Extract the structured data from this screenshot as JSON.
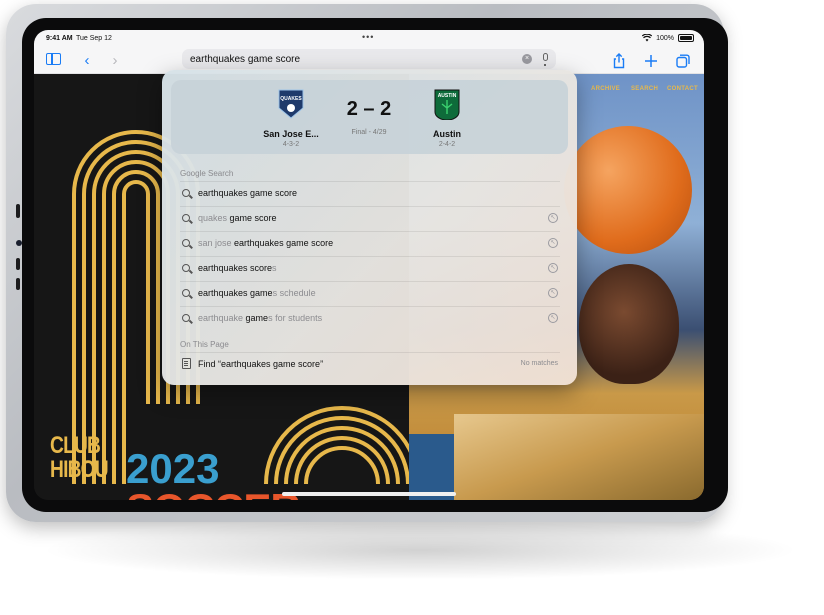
{
  "status_bar": {
    "time": "9:41 AM",
    "date": "Tue Sep 12",
    "battery": "100%"
  },
  "address_bar": {
    "query": "earthquakes game score"
  },
  "site": {
    "nav": [
      "ARCHIVE",
      "SEARCH",
      "CONTACT"
    ],
    "club_line1": "CLUB",
    "club_line2": "HIBOU",
    "year": "2023",
    "sport": "SOCCER"
  },
  "score_card": {
    "home": {
      "name": "San Jose E...",
      "record": "4-3-2",
      "crest_text": "QUAKES",
      "color": "#1f3a6b"
    },
    "score": "2 – 2",
    "status": "Final - 4/29",
    "away": {
      "name": "Austin",
      "record": "2-4-2",
      "crest_text": "AUSTIN",
      "color": "#0e6b3a"
    }
  },
  "google_section": "Google Search",
  "suggestions": [
    {
      "prefix": "",
      "bold": "earthquakes game score",
      "suffix": ""
    },
    {
      "prefix": "quakes ",
      "bold": "game score",
      "suffix": ""
    },
    {
      "prefix": "san jose ",
      "bold": "earthquakes game score",
      "suffix": ""
    },
    {
      "prefix": "",
      "bold": "earthquakes score",
      "suffix": "s"
    },
    {
      "prefix": "",
      "bold": "earthquakes game",
      "suffix": "s schedule"
    },
    {
      "prefix": "earthquake ",
      "bold": "game",
      "suffix": "s for students"
    }
  ],
  "page_section": "On This Page",
  "find": {
    "label": "Find “earthquakes game score”",
    "result": "No matches"
  },
  "colors": {
    "accent": "#1a7cf5",
    "gold": "#e7b84b",
    "blue": "#3a9fcf",
    "orange": "#e8562b"
  }
}
